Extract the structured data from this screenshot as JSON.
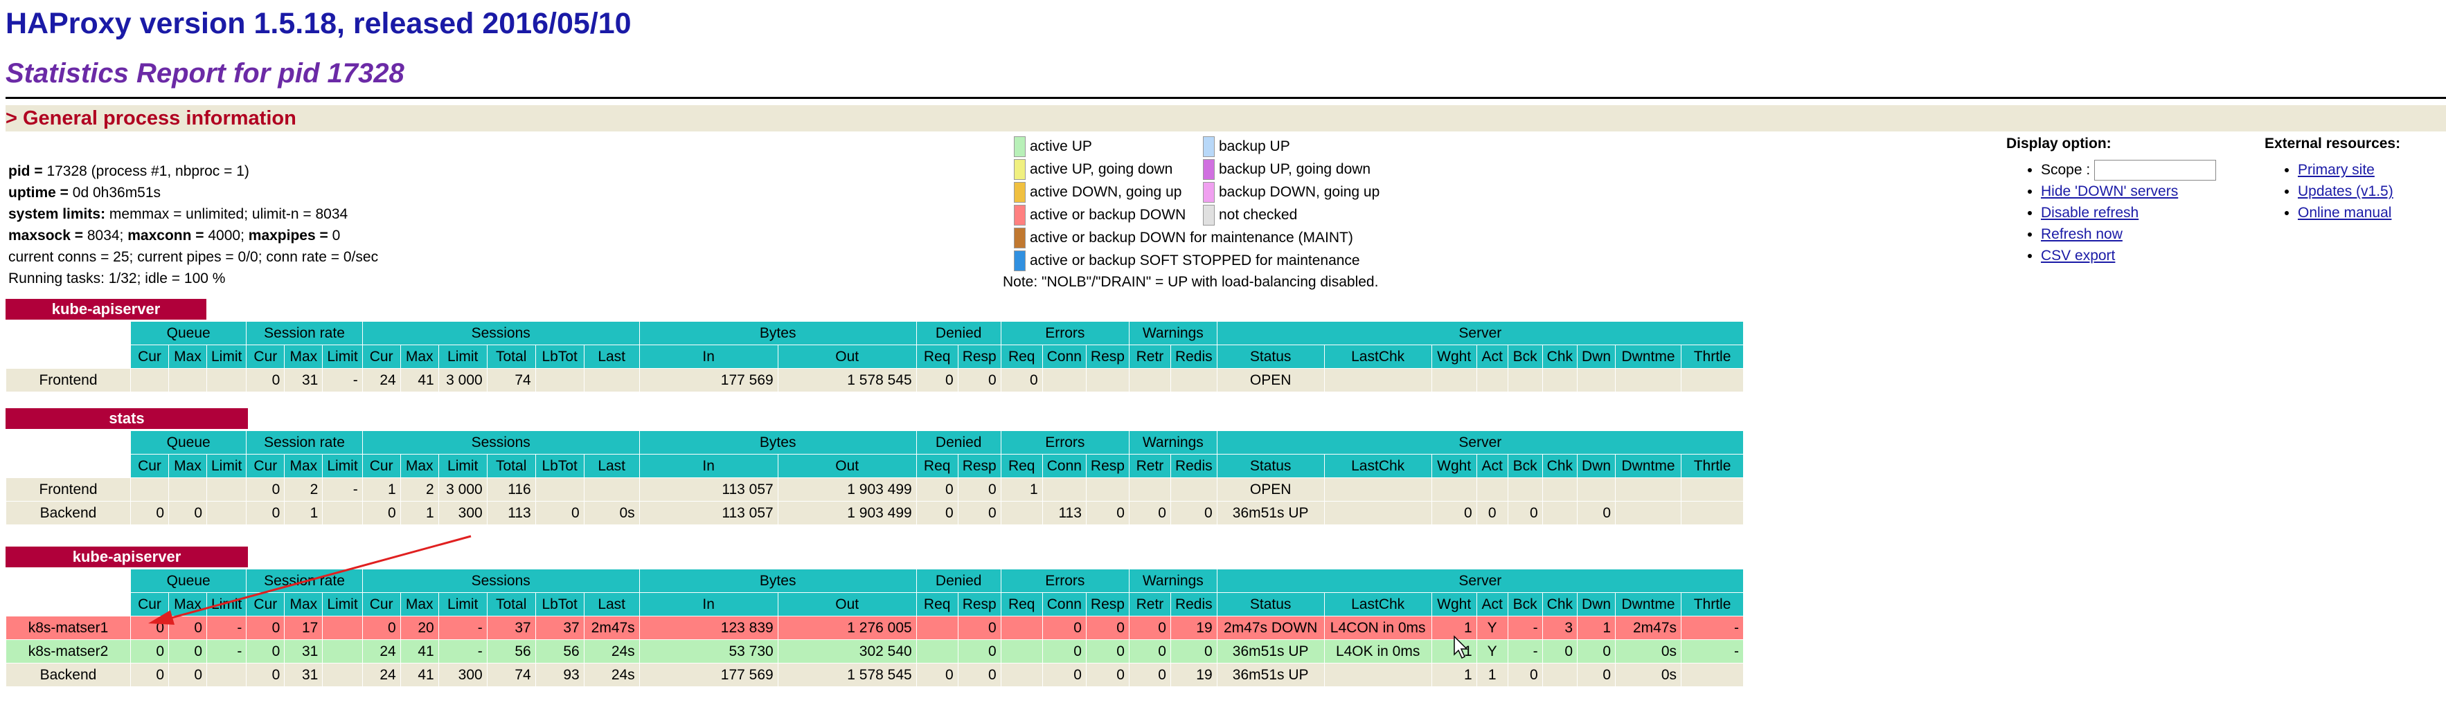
{
  "header": {
    "title": "HAProxy version 1.5.18, released 2016/05/10",
    "subtitle": "Statistics Report for pid 17328",
    "section": "> General process information"
  },
  "process_info": {
    "pid_label": "pid = ",
    "pid_value": "17328 (process #1, nbproc = 1)",
    "uptime_label": "uptime = ",
    "uptime_value": "0d 0h36m51s",
    "limits_label": "system limits: ",
    "limits_value": "memmax = unlimited; ulimit-n = 8034",
    "maxsock_label": "maxsock = ",
    "maxsock_value": "8034; ",
    "maxconn_label": "maxconn = ",
    "maxconn_value": "4000; ",
    "maxpipes_label": "maxpipes = ",
    "maxpipes_value": "0",
    "current": "current conns = 25; current pipes = 0/0; conn rate = 0/sec",
    "tasks": "Running tasks: 1/32; idle = 100 %"
  },
  "legend": {
    "left": [
      {
        "label": "active UP",
        "color": "#b8f0b8"
      },
      {
        "label": "active UP, going down",
        "color": "#f0f080"
      },
      {
        "label": "active DOWN, going up",
        "color": "#f0c040"
      },
      {
        "label": "active or backup DOWN",
        "color": "#ff8080"
      },
      {
        "label": "active or backup DOWN for maintenance (MAINT)",
        "color": "#c07830"
      },
      {
        "label": "active or backup SOFT STOPPED for maintenance",
        "color": "#3090e0"
      }
    ],
    "right": [
      {
        "label": "backup UP",
        "color": "#b8d8f8"
      },
      {
        "label": "backup UP, going down",
        "color": "#d070e0"
      },
      {
        "label": "backup DOWN, going up",
        "color": "#f0a0f0"
      },
      {
        "label": "not checked",
        "color": "#e0e0e0"
      }
    ],
    "note": "Note: \"NOLB\"/\"DRAIN\" = UP with load-balancing disabled."
  },
  "display_options": {
    "title": "Display option:",
    "scope_label": "Scope :",
    "scope_value": "",
    "links": [
      "Hide 'DOWN' servers",
      "Disable refresh",
      "Refresh now",
      "CSV export"
    ]
  },
  "external_resources": {
    "title": "External resources:",
    "links": [
      "Primary site",
      "Updates (v1.5)",
      "Online manual"
    ]
  },
  "column_groups": [
    "Queue",
    "Session rate",
    "Sessions",
    "Bytes",
    "Denied",
    "Errors",
    "Warnings",
    "Server"
  ],
  "columns": [
    "Cur",
    "Max",
    "Limit",
    "Cur",
    "Max",
    "Limit",
    "Cur",
    "Max",
    "Limit",
    "Total",
    "LbTot",
    "Last",
    "In",
    "Out",
    "Req",
    "Resp",
    "Req",
    "Conn",
    "Resp",
    "Retr",
    "Redis",
    "Status",
    "LastChk",
    "Wght",
    "Act",
    "Bck",
    "Chk",
    "Dwn",
    "Dwntme",
    "Thrtle"
  ],
  "proxies": [
    {
      "name": "kube-apiserver",
      "rows": [
        {
          "kind": "front",
          "cells": [
            "Frontend",
            "",
            "",
            "",
            "0",
            "31",
            "-",
            "24",
            "41",
            "3 000",
            "74",
            "",
            "",
            "177 569",
            "1 578 545",
            "0",
            "0",
            "0",
            "",
            "",
            "",
            "",
            "OPEN",
            "",
            "",
            "",
            "",
            "",
            "",
            "",
            ""
          ]
        }
      ]
    },
    {
      "name": "stats",
      "rows": [
        {
          "kind": "front",
          "cells": [
            "Frontend",
            "",
            "",
            "",
            "0",
            "2",
            "-",
            "1",
            "2",
            "3 000",
            "116",
            "",
            "",
            "113 057",
            "1 903 499",
            "0",
            "0",
            "1",
            "",
            "",
            "",
            "",
            "OPEN",
            "",
            "",
            "",
            "",
            "",
            "",
            "",
            ""
          ]
        },
        {
          "kind": "back",
          "cells": [
            "Backend",
            "0",
            "0",
            "",
            "0",
            "1",
            "",
            "0",
            "1",
            "300",
            "113",
            "0",
            "0s",
            "113 057",
            "1 903 499",
            "0",
            "0",
            "",
            "113",
            "0",
            "0",
            "0",
            "36m51s UP",
            "",
            "0",
            "0",
            "0",
            "",
            "0",
            "",
            ""
          ]
        }
      ]
    },
    {
      "name": "kube-apiserver",
      "rows": [
        {
          "kind": "down",
          "cells": [
            "k8s-matser1",
            "0",
            "0",
            "-",
            "0",
            "17",
            "",
            "0",
            "20",
            "-",
            "37",
            "37",
            "2m47s",
            "123 839",
            "1 276 005",
            "",
            "0",
            "",
            "0",
            "0",
            "0",
            "19",
            "2m47s DOWN",
            "L4CON in 0ms",
            "1",
            "Y",
            "-",
            "3",
            "1",
            "2m47s",
            "-"
          ]
        },
        {
          "kind": "up",
          "cells": [
            "k8s-matser2",
            "0",
            "0",
            "-",
            "0",
            "31",
            "",
            "24",
            "41",
            "-",
            "56",
            "56",
            "24s",
            "53 730",
            "302 540",
            "",
            "0",
            "",
            "0",
            "0",
            "0",
            "0",
            "36m51s UP",
            "L4OK in 0ms",
            "1",
            "Y",
            "-",
            "0",
            "0",
            "0s",
            "-"
          ]
        },
        {
          "kind": "back",
          "cells": [
            "Backend",
            "0",
            "0",
            "",
            "0",
            "31",
            "",
            "24",
            "41",
            "300",
            "74",
            "93",
            "24s",
            "177 569",
            "1 578 545",
            "0",
            "0",
            "",
            "0",
            "0",
            "0",
            "19",
            "36m51s UP",
            "",
            "1",
            "1",
            "0",
            "",
            "0",
            "0s",
            ""
          ]
        }
      ]
    }
  ]
}
